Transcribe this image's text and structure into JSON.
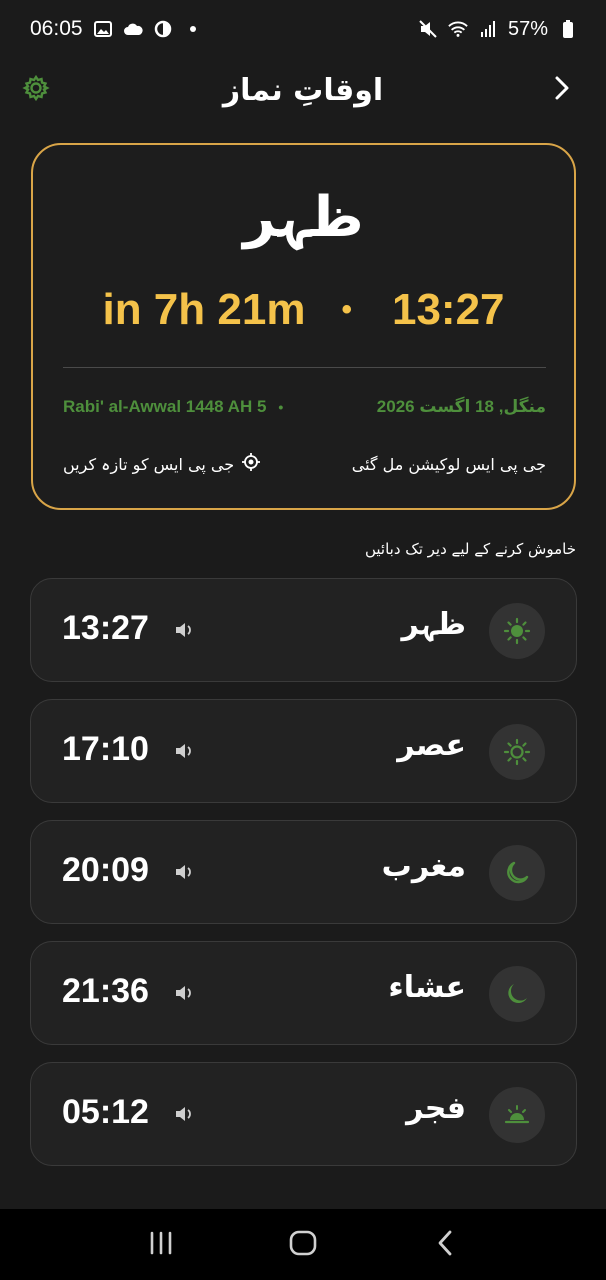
{
  "status_bar": {
    "time": "06:05",
    "battery": "57%",
    "icons": [
      "image-icon",
      "cloud-icon",
      "brightness-icon",
      "dot-icon",
      "mute-icon",
      "wifi-icon",
      "signal-icon",
      "battery-icon"
    ]
  },
  "header": {
    "title": "اوقاتِ نماز",
    "settings_icon": "gear-icon",
    "back_icon": "chevron-right-icon"
  },
  "next_prayer": {
    "name": "ظہر",
    "remaining": "in 7h 21m",
    "separator": "•",
    "time": "13:27",
    "hijri_date": "Rabi' al-Awwal 1448 AH 5",
    "date_separator": "•",
    "gregorian_date": "منگل, 18 اگست 2026",
    "gps_status": "جی پی ایس لوکیشن مل گئی",
    "refresh_gps_label": "جی پی ایس کو تازہ کریں",
    "refresh_icon": "gps-target-icon",
    "accent_color": "#f4c24a",
    "border_color": "#d9a548",
    "date_color": "#4e8f3c"
  },
  "hint": "خاموش کرنے کے لیے دیر تک دبائیں",
  "prayers": [
    {
      "name": "ظہر",
      "time": "13:27",
      "icon": "sun-icon",
      "sound_icon": "speaker-icon"
    },
    {
      "name": "عصر",
      "time": "17:10",
      "icon": "sun-outline-icon",
      "sound_icon": "speaker-icon"
    },
    {
      "name": "مغرب",
      "time": "20:09",
      "icon": "moon-outline-icon",
      "sound_icon": "speaker-icon"
    },
    {
      "name": "عشاء",
      "time": "21:36",
      "icon": "moon-filled-icon",
      "sound_icon": "speaker-icon"
    },
    {
      "name": "فجر",
      "time": "05:12",
      "icon": "sunrise-icon",
      "sound_icon": "speaker-icon"
    }
  ],
  "icon_color": "#4e8f3c",
  "nav_bar": {
    "buttons": [
      "recents-icon",
      "home-icon",
      "back-nav-icon"
    ]
  }
}
